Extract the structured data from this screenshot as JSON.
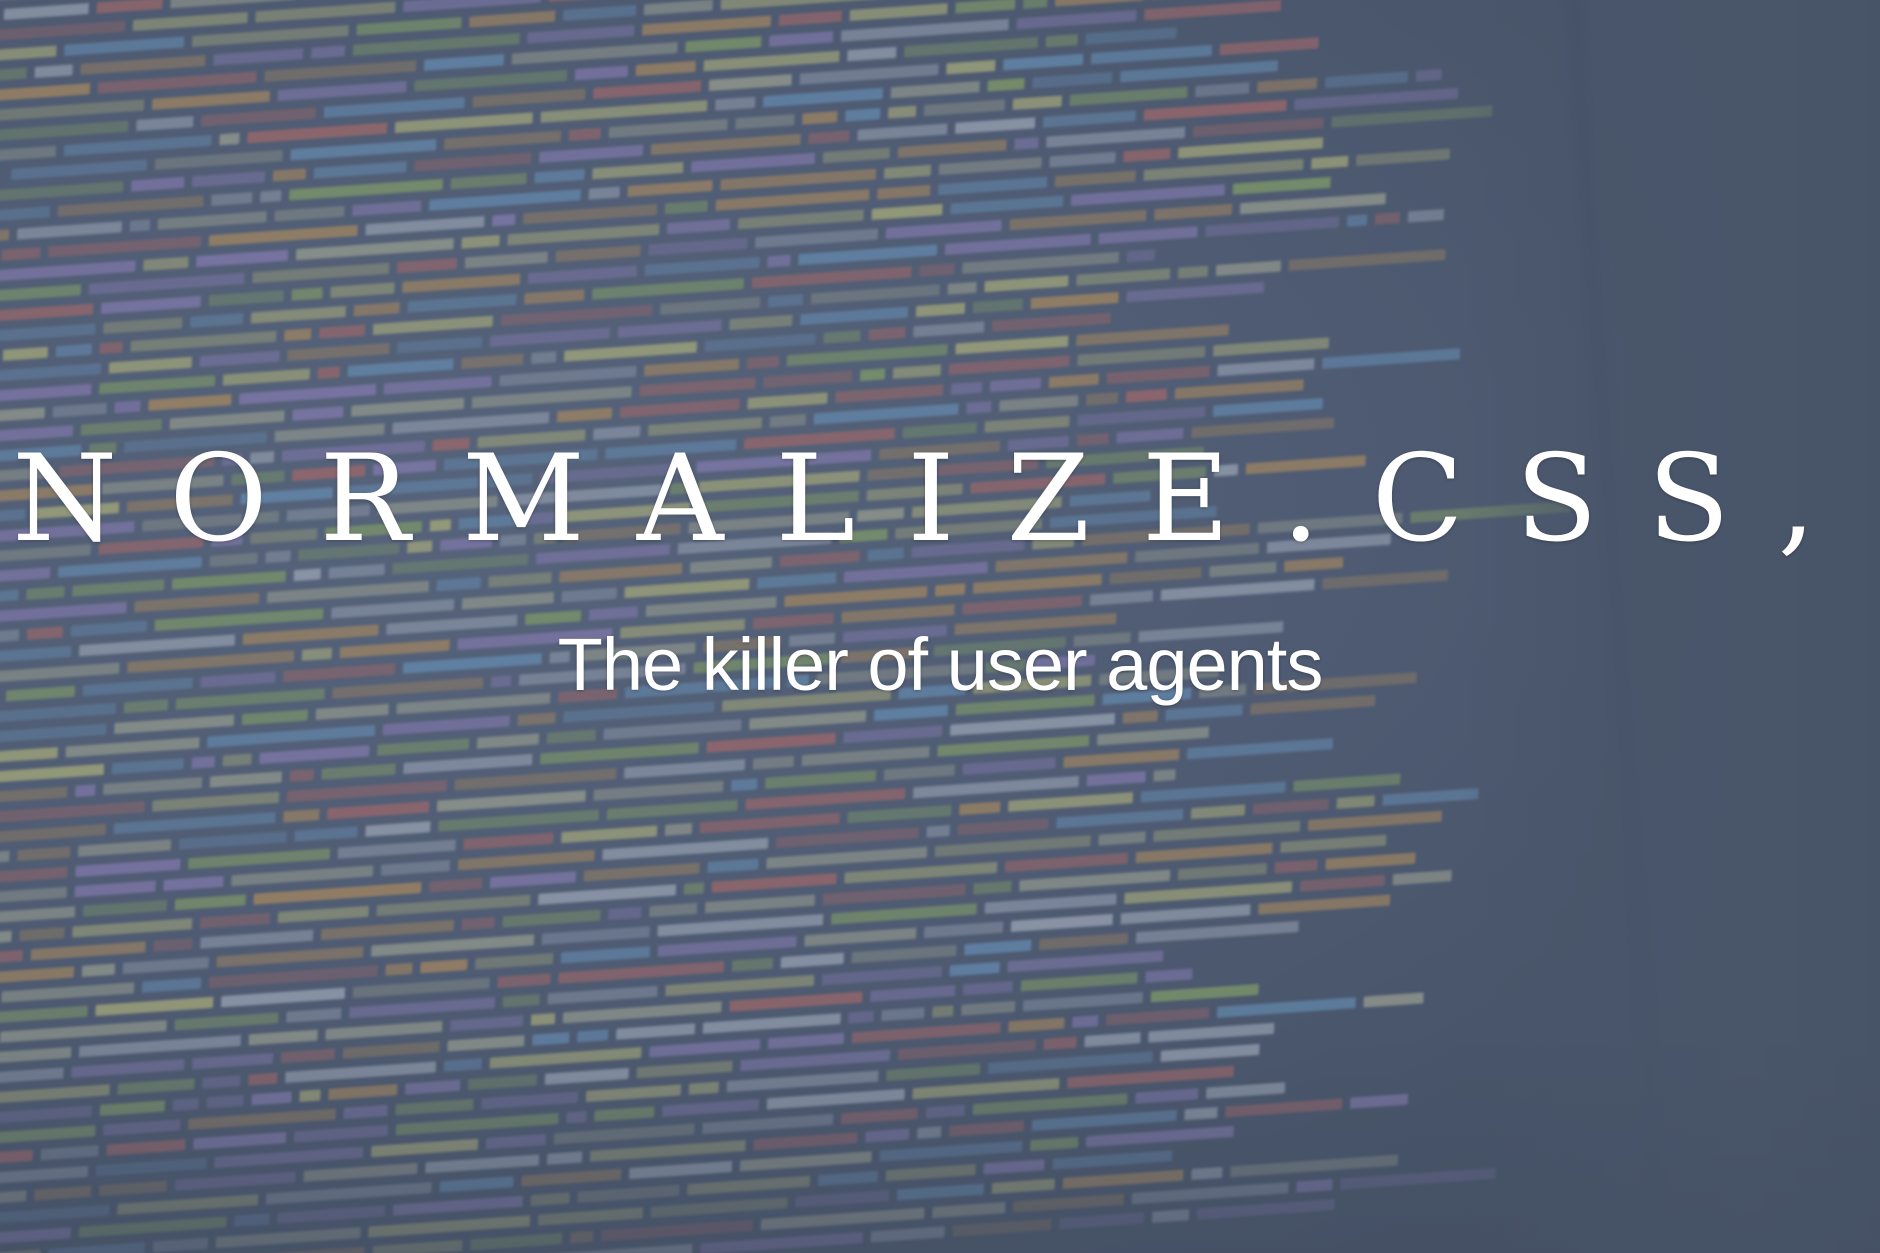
{
  "hero": {
    "title": "NORMALIZE.CSS,",
    "subtitle": "The killer of user agents"
  },
  "colors": {
    "overlay": "#5a6680",
    "text": "#ffffff",
    "code_palette": [
      "#c9c9a0",
      "#9fc35a",
      "#e3a34b",
      "#6fa8d8",
      "#d86b5c",
      "#e7e27a",
      "#cfd6e2",
      "#a58bd6"
    ]
  }
}
